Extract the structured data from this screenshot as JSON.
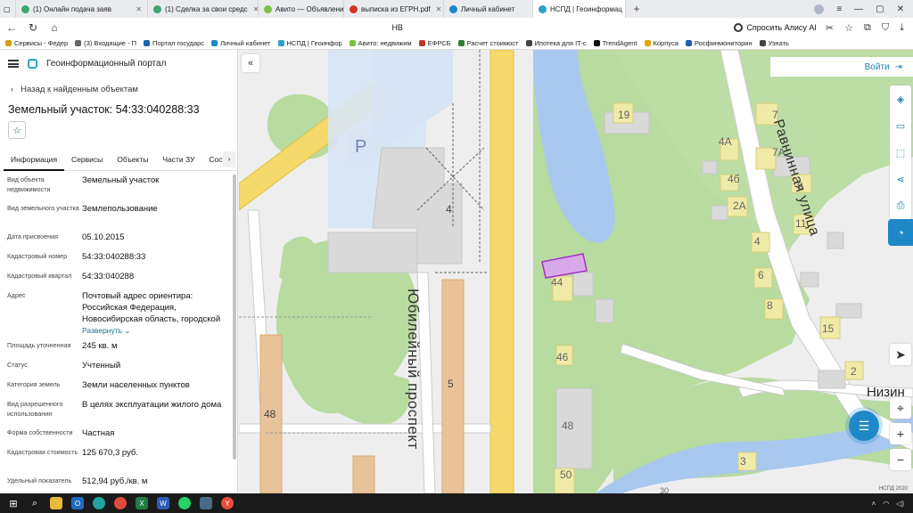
{
  "browser": {
    "tabs": [
      {
        "label": "(1) Онлайн подача заяв",
        "color": "#3aa870"
      },
      {
        "label": "(1) Сделка за свои средс",
        "color": "#3aa870"
      },
      {
        "label": "Авито — Объявления на",
        "color": "#7ac143"
      },
      {
        "label": "выписка из ЕГРН.pdf",
        "color": "#d93025"
      },
      {
        "label": "Личный кабинет",
        "color": "#1e88c8"
      },
      {
        "label": "НСПД | Геоинформац",
        "color": "#2aa3c7",
        "active": true
      }
    ],
    "address_partial": "НВ",
    "alice_label": "Спросить Алису AI",
    "bookmarks": [
      {
        "label": "Сервисы - Федер",
        "color": "#d4a017"
      },
      {
        "label": "(3) Входящие - П",
        "color": "#666"
      },
      {
        "label": "Портал государс",
        "color": "#1e60b0"
      },
      {
        "label": "Личный кабинет",
        "color": "#1e88c8"
      },
      {
        "label": "НСПД | Геоинфор",
        "color": "#2aa3c7"
      },
      {
        "label": "Авито: недвижим",
        "color": "#7ac143"
      },
      {
        "label": "ЕФРСБ",
        "color": "#c0392b"
      },
      {
        "label": "Расчет стоимост",
        "color": "#2e7d32"
      },
      {
        "label": "Ипотека для IT-с",
        "color": "#444"
      },
      {
        "label": "TrendAgent",
        "color": "#111"
      },
      {
        "label": "Корпуса",
        "color": "#e0a800"
      },
      {
        "label": "Росфинмониторин",
        "color": "#1e60b0"
      },
      {
        "label": "Узнать",
        "color": "#444"
      }
    ]
  },
  "panel": {
    "app_title": "Геоинформационный портал",
    "back_label": "Назад к найденным объектам",
    "parcel_title": "Земельный участок: 54:33:040288:33",
    "tabs": [
      "Информация",
      "Сервисы",
      "Объекты",
      "Части ЗУ",
      "Состав"
    ],
    "rows": [
      {
        "label": "Вид объекта недвижимости",
        "value": "Земельный участок"
      },
      {
        "label": "Вид земельного участка",
        "value": "Землепользование"
      },
      {
        "label": "Дата присвоения",
        "value": "05.10.2015"
      },
      {
        "label": "Кадастровый номер",
        "value": "54:33:040288:33"
      },
      {
        "label": "Кадастровый квартал",
        "value": "54:33:040288"
      },
      {
        "label": "Адрес",
        "value": "Почтовый адрес ориентира: Российская Федерация, Новосибирская область, городской",
        "expand": "Развернуть"
      },
      {
        "label": "Площадь уточненная",
        "value": "245 кв. м"
      },
      {
        "label": "Статус",
        "value": "Учтенный"
      },
      {
        "label": "Категория земель",
        "value": "Земли населенных пунктов"
      },
      {
        "label": "Вид разрешенного использования",
        "value": "В целях эксплуатации жилого дома"
      },
      {
        "label": "Форма собственности",
        "value": "Частная"
      },
      {
        "label": "Кадастровая стоимость",
        "value": "125 670,3 руб."
      },
      {
        "label": "Удельный показатель",
        "value": "512,94 руб./кв. м"
      }
    ]
  },
  "map": {
    "login_label": "Войти",
    "roads": {
      "main": "Юбилейный проспект",
      "side": "Равнинная улица",
      "cut": "Низин"
    },
    "parking_label": "P",
    "house_numbers": [
      "19",
      "7",
      "4А",
      "7А",
      "4б",
      "9",
      "2А",
      "11",
      "4",
      "6",
      "8",
      "15",
      "2",
      "4",
      "44",
      "46",
      "48",
      "5",
      "48",
      "50",
      "3",
      "30"
    ],
    "scale_label": "НСПД 2020"
  },
  "colors": {
    "accent": "#1e88c8",
    "water": "#a8c8f0",
    "green": "#b8dba0",
    "road": "#f5d96b",
    "building": "#d9d9d9",
    "yellow_building": "#f0eaa8",
    "selected_parcel": "#d9a8e8"
  }
}
